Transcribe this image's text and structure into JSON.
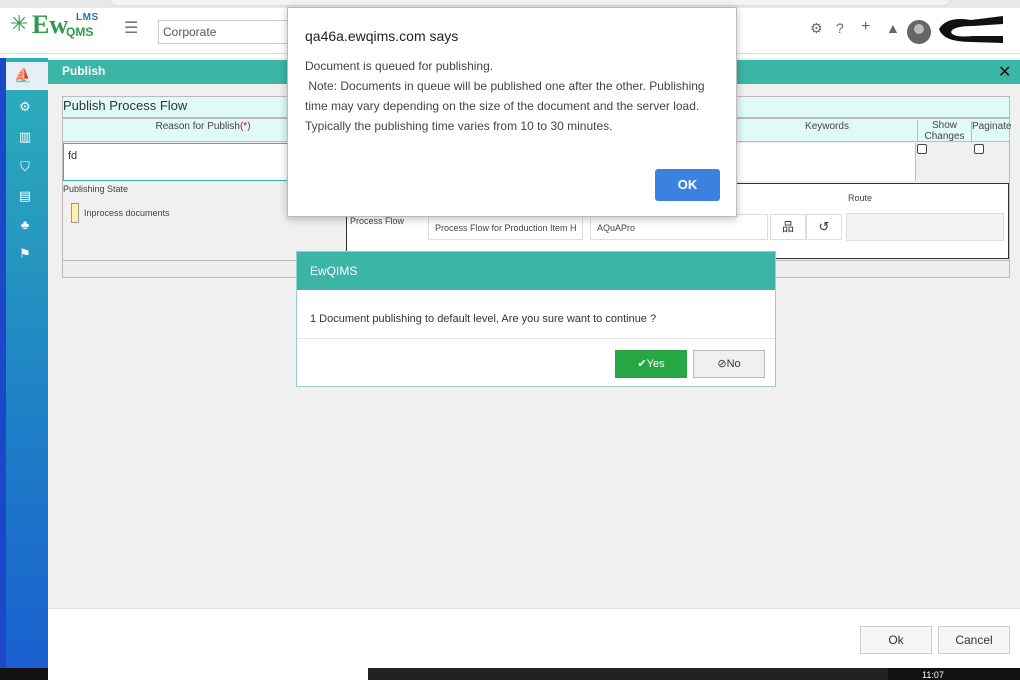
{
  "header": {
    "logo_ew": "Ew",
    "logo_lms": "LMS",
    "logo_qms": "QMS",
    "unit_selector": "Corporate"
  },
  "publish_panel": {
    "title": "Publish",
    "flow_title": "Publish Process Flow",
    "reason_header": "Reason for Publish",
    "required_mark": "(*)",
    "keywords_header": "Keywords",
    "show_changes_header": "Show Changes",
    "paginate_header": "Paginate",
    "reason_value": "fd",
    "publishing_state_label": "Publishing State",
    "state_legend": "Inprocess documents",
    "route_header": "Route",
    "process_flow_label": "Process Flow",
    "process_flow_value": "Process Flow for Production Item H",
    "assignee_value": "AQuAPro",
    "ok_button": "Ok",
    "cancel_button": "Cancel"
  },
  "confirm_dialog": {
    "title": "EwQIMS",
    "message": "1 Document publishing to default level, Are you sure want to continue ?",
    "yes_label": "Yes",
    "no_label": "No"
  },
  "alert_dialog": {
    "origin": "qa46a.ewqims.com says",
    "line1": "Document is queued for publishing.",
    "line2": " Note: Documents in queue will be published one after the other. Publishing time may vary depending on the size of the document and the server load. Typically the publishing time varies from 10 to 30 minutes.",
    "ok_label": "OK"
  },
  "taskbar": {
    "clock": "11:07"
  },
  "colors": {
    "teal": "#3bb5a5",
    "success": "#28a745",
    "primary": "#3b82e0"
  }
}
